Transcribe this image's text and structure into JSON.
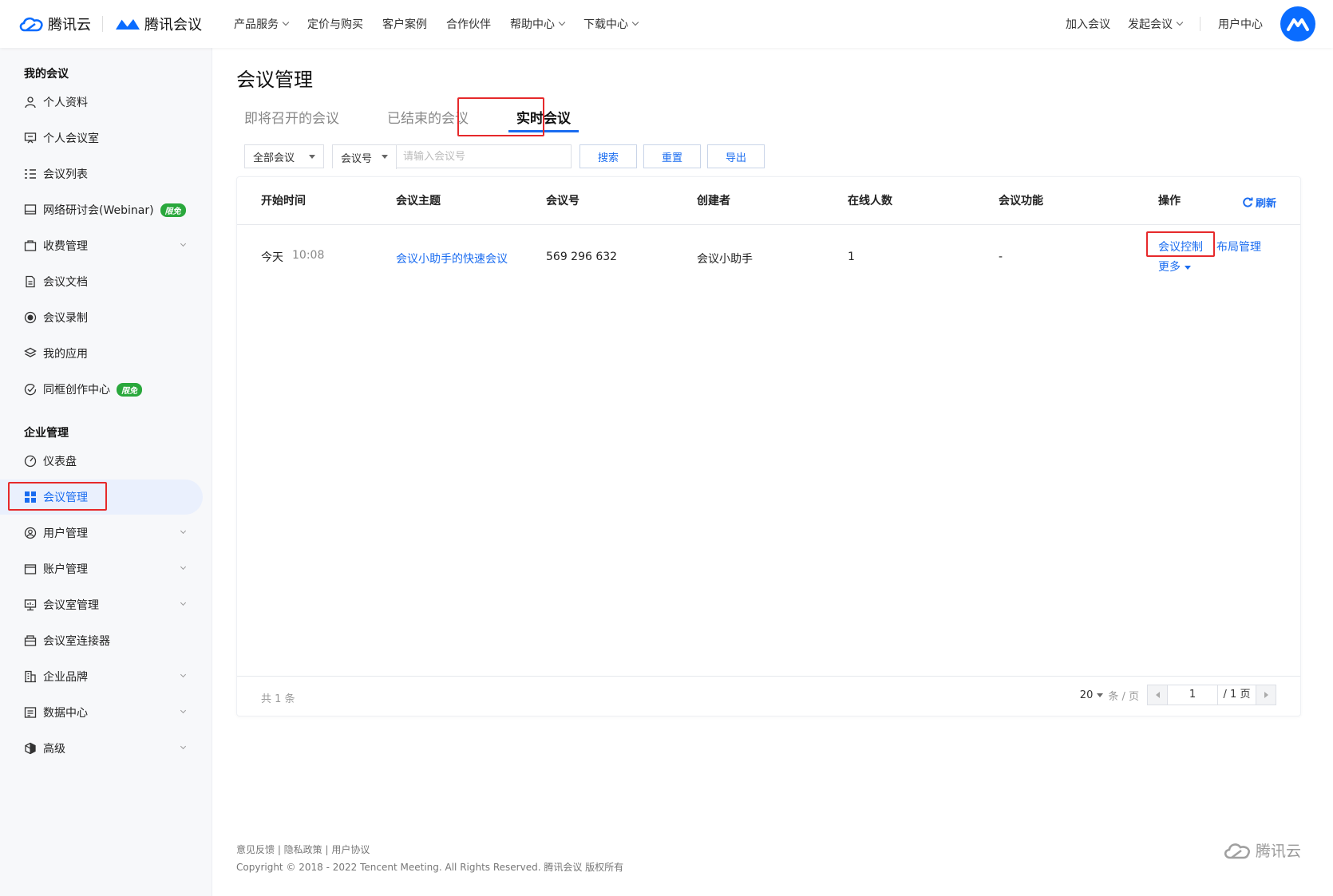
{
  "header": {
    "brand_cloud": "腾讯云",
    "brand_meeting": "腾讯会议",
    "nav": [
      {
        "label": "产品服务",
        "dropdown": true
      },
      {
        "label": "定价与购买",
        "dropdown": false
      },
      {
        "label": "客户案例",
        "dropdown": false
      },
      {
        "label": "合作伙伴",
        "dropdown": false
      },
      {
        "label": "帮助中心",
        "dropdown": true
      },
      {
        "label": "下载中心",
        "dropdown": true
      }
    ],
    "right": {
      "join": "加入会议",
      "start": "发起会议",
      "user_center": "用户中心"
    }
  },
  "sidebar": {
    "group_my": "我的会议",
    "my_items": [
      {
        "label": "个人资料",
        "icon": "user-icon"
      },
      {
        "label": "个人会议室",
        "icon": "meeting-room-icon"
      },
      {
        "label": "会议列表",
        "icon": "list-icon"
      },
      {
        "label": "网络研讨会(Webinar)",
        "icon": "webinar-icon",
        "badge": "限免"
      },
      {
        "label": "收费管理",
        "icon": "billing-icon",
        "dropdown": true
      },
      {
        "label": "会议文档",
        "icon": "document-icon"
      },
      {
        "label": "会议录制",
        "icon": "record-icon"
      },
      {
        "label": "我的应用",
        "icon": "apps-icon"
      },
      {
        "label": "同框创作中心",
        "icon": "creation-icon",
        "badge": "限免"
      }
    ],
    "group_enterprise": "企业管理",
    "enterprise_items": [
      {
        "label": "仪表盘",
        "icon": "dashboard-icon"
      },
      {
        "label": "会议管理",
        "icon": "grid-icon",
        "active": true
      },
      {
        "label": "用户管理",
        "icon": "users-icon",
        "dropdown": true
      },
      {
        "label": "账户管理",
        "icon": "account-icon",
        "dropdown": true
      },
      {
        "label": "会议室管理",
        "icon": "room-manage-icon",
        "dropdown": true
      },
      {
        "label": "会议室连接器",
        "icon": "connector-icon"
      },
      {
        "label": "企业品牌",
        "icon": "brand-icon",
        "dropdown": true
      },
      {
        "label": "数据中心",
        "icon": "data-icon",
        "dropdown": true
      },
      {
        "label": "高级",
        "icon": "advanced-icon",
        "dropdown": true
      }
    ]
  },
  "main": {
    "title": "会议管理",
    "tabs": [
      {
        "label": "即将召开的会议",
        "active": false
      },
      {
        "label": "已结束的会议",
        "active": false
      },
      {
        "label": "实时会议",
        "active": true
      }
    ],
    "filters": {
      "scope_select": "全部会议",
      "field_select": "会议号",
      "search_placeholder": "请输入会议号",
      "search_value": "",
      "search_btn": "搜索",
      "reset_btn": "重置",
      "export_btn": "导出"
    },
    "table": {
      "columns": [
        "开始时间",
        "会议主题",
        "会议号",
        "创建者",
        "在线人数",
        "会议功能",
        "操作"
      ],
      "refresh": "刷新",
      "rows": [
        {
          "date": "今天",
          "time": "10:08",
          "topic": "会议小助手的快速会议",
          "meeting_id": "569 296 632",
          "creator": "会议小助手",
          "online": "1",
          "features": "-",
          "actions": {
            "control": "会议控制",
            "layout": "布局管理",
            "more": "更多"
          }
        }
      ],
      "footer": {
        "total": "共 1 条",
        "page_size": "20",
        "page_unit": "条 / 页",
        "current_page": "1",
        "total_pages": "/ 1 页"
      }
    }
  },
  "footer": {
    "links": "意见反馈 | 隐私政策 | 用户协议",
    "copyright": "Copyright © 2018 - 2022 Tencent Meeting. All Rights Reserved. 腾讯会议 版权所有",
    "logo_text": "腾讯云"
  },
  "colors": {
    "accent": "#1a6cf0",
    "highlight": "#e6292b",
    "badge": "#2aa83c"
  }
}
